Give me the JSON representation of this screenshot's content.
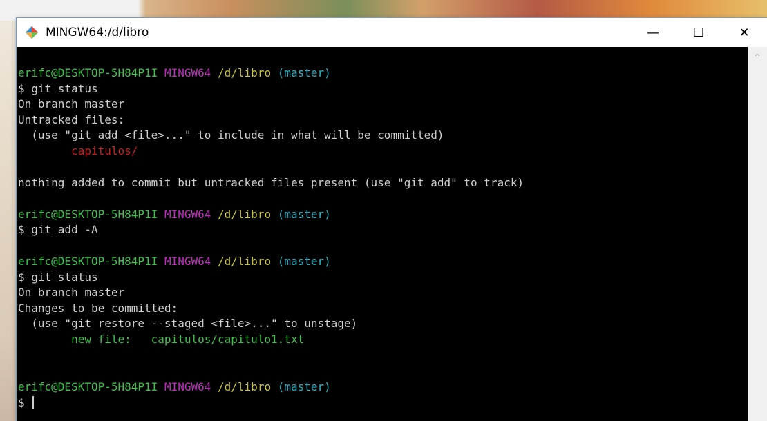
{
  "window": {
    "title": "MINGW64:/d/libro",
    "minimize_glyph": "—",
    "maximize_glyph": "☐",
    "close_glyph": "✕",
    "app_icon": "git-bash-icon"
  },
  "scrollbar": {
    "up_arrow": "^"
  },
  "prompt": {
    "user": "erifc@DESKTOP-5H84P1I",
    "system": "MINGW64",
    "path": "/d/libro",
    "branch": "(master)",
    "symbol": "$"
  },
  "session": {
    "cmd1": "$ git status",
    "out1_branch": "On branch master",
    "out1_untracked": "Untracked files:",
    "out1_hint": "  (use \"git add <file>...\" to include in what will be committed)",
    "out1_file": "        capitulos/",
    "out1_summary": "nothing added to commit but untracked files present (use \"git add\" to track)",
    "cmd2": "$ git add -A",
    "cmd3": "$ git status",
    "out3_branch": "On branch master",
    "out3_changes": "Changes to be committed:",
    "out3_hint": "  (use \"git restore --staged <file>...\" to unstage)",
    "out3_label": "        new file:   ",
    "out3_file": "capitulos/capitulo1.txt",
    "final_prompt": "$ "
  },
  "colors": {
    "user": "#3cc34a",
    "system": "#bd2ebd",
    "path": "#c9c533",
    "branch": "#2fb3c4",
    "untracked": "#c81e1e",
    "staged": "#3cc34a"
  }
}
